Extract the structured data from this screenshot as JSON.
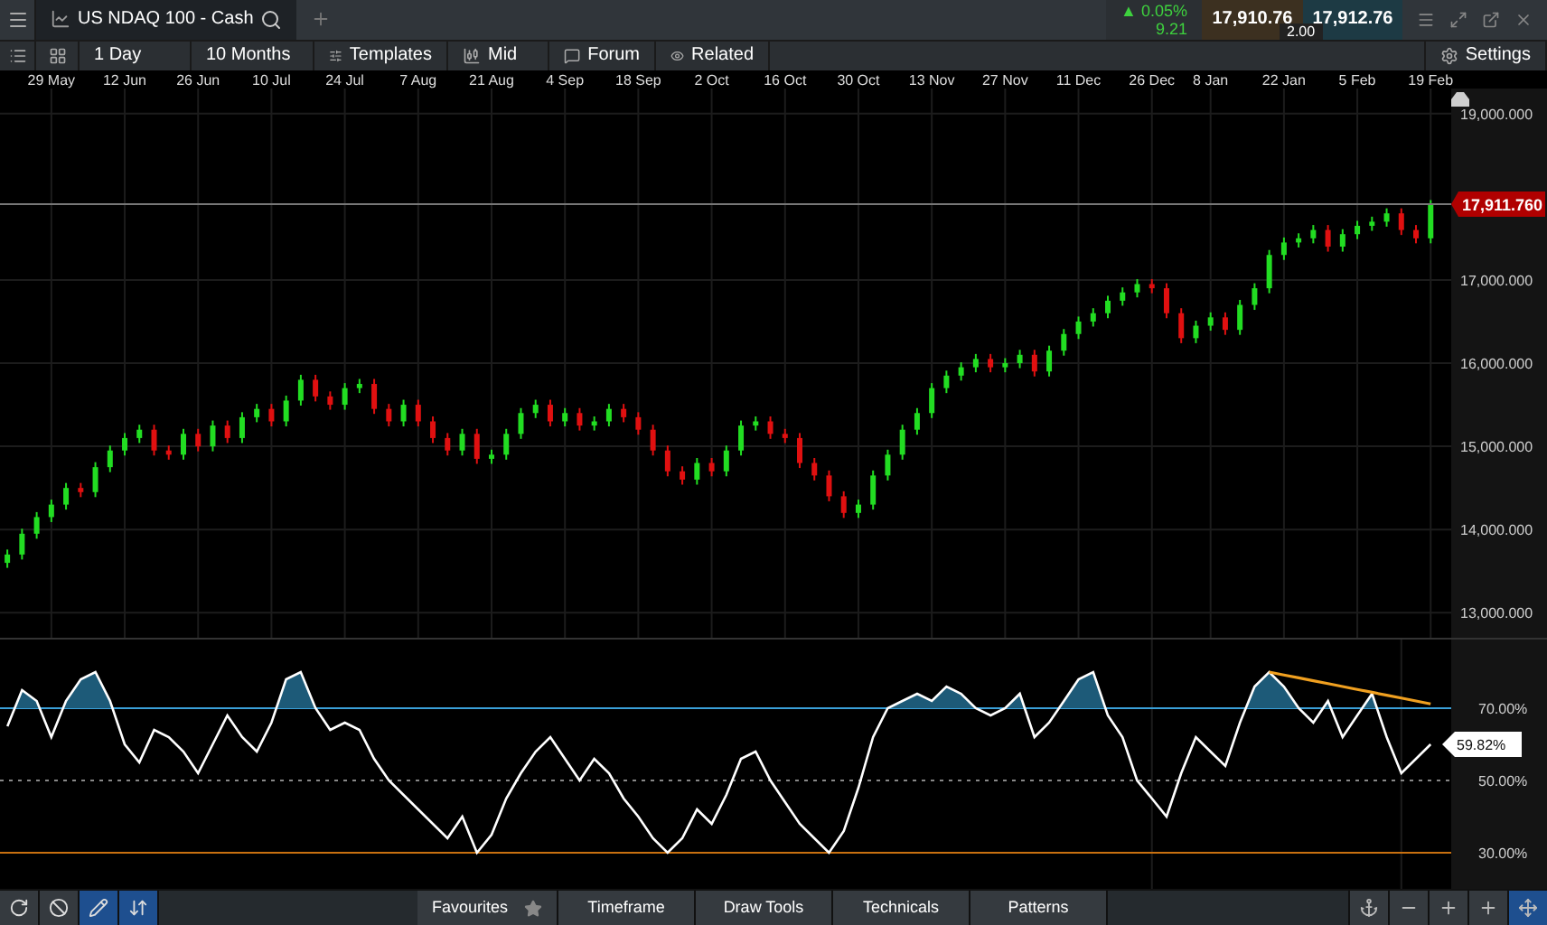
{
  "tab": {
    "title": "US NDAQ 100 - Cash"
  },
  "quote": {
    "change_arrow": "▲",
    "change": "0.05%",
    "change_points": "9.21",
    "sell": "17,910.76",
    "buy": "17,912.76",
    "spread": "2.00"
  },
  "toolbar": {
    "interval": "1 Day",
    "period": "10 Months",
    "templates": "Templates",
    "price_type": "Mid",
    "forum": "Forum",
    "related": "Related",
    "settings": "Settings"
  },
  "price_chart": {
    "chart_data": {
      "type": "candlestick",
      "grid": true,
      "categories": [
        null,
        null,
        null,
        "29 May",
        null,
        null,
        null,
        null,
        "12 Jun",
        null,
        null,
        null,
        null,
        "26 Jun",
        null,
        null,
        null,
        null,
        "10 Jul",
        null,
        null,
        null,
        null,
        "24 Jul",
        null,
        null,
        null,
        null,
        "7 Aug",
        null,
        null,
        null,
        null,
        "21 Aug",
        null,
        null,
        null,
        null,
        "4 Sep",
        null,
        null,
        null,
        null,
        "18 Sep",
        null,
        null,
        null,
        null,
        "2 Oct",
        null,
        null,
        null,
        null,
        "16 Oct",
        null,
        null,
        null,
        null,
        "30 Oct",
        null,
        null,
        null,
        null,
        "13 Nov",
        null,
        null,
        null,
        null,
        "27 Nov",
        null,
        null,
        null,
        null,
        "11 Dec",
        null,
        null,
        null,
        null,
        "26 Dec",
        null,
        null,
        null,
        "8 Jan",
        null,
        null,
        null,
        null,
        "22 Jan",
        null,
        null,
        null,
        null,
        "5 Feb",
        null,
        null,
        null,
        null,
        "19 Feb"
      ],
      "ohlc": [
        [
          13600,
          13760,
          13540,
          13700
        ],
        [
          13700,
          14010,
          13640,
          13950
        ],
        [
          13950,
          14210,
          13890,
          14150
        ],
        [
          14150,
          14360,
          14090,
          14300
        ],
        [
          14300,
          14560,
          14240,
          14500
        ],
        [
          14500,
          14560,
          14390,
          14450
        ],
        [
          14450,
          14810,
          14390,
          14750
        ],
        [
          14750,
          15010,
          14690,
          14950
        ],
        [
          14950,
          15160,
          14890,
          15100
        ],
        [
          15100,
          15260,
          15040,
          15200
        ],
        [
          15200,
          15260,
          14890,
          14950
        ],
        [
          14950,
          15010,
          14840,
          14900
        ],
        [
          14900,
          15210,
          14840,
          15150
        ],
        [
          15150,
          15210,
          14940,
          15000
        ],
        [
          15000,
          15310,
          14940,
          15250
        ],
        [
          15250,
          15310,
          15040,
          15100
        ],
        [
          15100,
          15410,
          15040,
          15350
        ],
        [
          15350,
          15510,
          15290,
          15450
        ],
        [
          15450,
          15510,
          15240,
          15300
        ],
        [
          15300,
          15610,
          15240,
          15550
        ],
        [
          15550,
          15860,
          15490,
          15800
        ],
        [
          15800,
          15860,
          15540,
          15600
        ],
        [
          15600,
          15660,
          15440,
          15500
        ],
        [
          15500,
          15760,
          15440,
          15700
        ],
        [
          15700,
          15810,
          15640,
          15750
        ],
        [
          15750,
          15810,
          15390,
          15450
        ],
        [
          15450,
          15510,
          15240,
          15300
        ],
        [
          15300,
          15560,
          15240,
          15500
        ],
        [
          15500,
          15560,
          15240,
          15300
        ],
        [
          15300,
          15360,
          15040,
          15100
        ],
        [
          15100,
          15160,
          14890,
          14950
        ],
        [
          14950,
          15210,
          14890,
          15150
        ],
        [
          15150,
          15210,
          14790,
          14850
        ],
        [
          14850,
          14960,
          14790,
          14900
        ],
        [
          14900,
          15210,
          14840,
          15150
        ],
        [
          15150,
          15460,
          15090,
          15400
        ],
        [
          15400,
          15560,
          15340,
          15500
        ],
        [
          15500,
          15560,
          15240,
          15300
        ],
        [
          15300,
          15460,
          15240,
          15400
        ],
        [
          15400,
          15460,
          15190,
          15250
        ],
        [
          15250,
          15360,
          15190,
          15300
        ],
        [
          15300,
          15510,
          15240,
          15450
        ],
        [
          15450,
          15510,
          15290,
          15350
        ],
        [
          15350,
          15410,
          15140,
          15200
        ],
        [
          15200,
          15260,
          14890,
          14950
        ],
        [
          14950,
          15010,
          14640,
          14700
        ],
        [
          14700,
          14760,
          14540,
          14600
        ],
        [
          14600,
          14860,
          14540,
          14800
        ],
        [
          14800,
          14860,
          14640,
          14700
        ],
        [
          14700,
          15010,
          14640,
          14950
        ],
        [
          14950,
          15310,
          14890,
          15250
        ],
        [
          15250,
          15360,
          15190,
          15300
        ],
        [
          15300,
          15360,
          15090,
          15150
        ],
        [
          15150,
          15210,
          15040,
          15100
        ],
        [
          15100,
          15160,
          14740,
          14800
        ],
        [
          14800,
          14860,
          14590,
          14650
        ],
        [
          14650,
          14710,
          14340,
          14400
        ],
        [
          14400,
          14460,
          14140,
          14200
        ],
        [
          14200,
          14360,
          14140,
          14300
        ],
        [
          14300,
          14710,
          14240,
          14650
        ],
        [
          14650,
          14960,
          14590,
          14900
        ],
        [
          14900,
          15260,
          14840,
          15200
        ],
        [
          15200,
          15460,
          15140,
          15400
        ],
        [
          15400,
          15760,
          15340,
          15700
        ],
        [
          15700,
          15910,
          15640,
          15850
        ],
        [
          15850,
          16010,
          15790,
          15950
        ],
        [
          15950,
          16110,
          15890,
          16050
        ],
        [
          16050,
          16110,
          15890,
          15950
        ],
        [
          15950,
          16060,
          15890,
          16000
        ],
        [
          16000,
          16160,
          15940,
          16100
        ],
        [
          16100,
          16160,
          15840,
          15900
        ],
        [
          15900,
          16210,
          15840,
          16150
        ],
        [
          16150,
          16410,
          16090,
          16350
        ],
        [
          16350,
          16560,
          16290,
          16500
        ],
        [
          16500,
          16660,
          16440,
          16600
        ],
        [
          16600,
          16810,
          16540,
          16750
        ],
        [
          16750,
          16910,
          16690,
          16850
        ],
        [
          16850,
          17010,
          16790,
          16950
        ],
        [
          16950,
          17010,
          16840,
          16900
        ],
        [
          16900,
          16960,
          16540,
          16600
        ],
        [
          16600,
          16660,
          16240,
          16300
        ],
        [
          16300,
          16510,
          16240,
          16450
        ],
        [
          16450,
          16610,
          16390,
          16550
        ],
        [
          16550,
          16610,
          16340,
          16400
        ],
        [
          16400,
          16760,
          16340,
          16700
        ],
        [
          16700,
          16960,
          16640,
          16900
        ],
        [
          16900,
          17360,
          16840,
          17300
        ],
        [
          17300,
          17510,
          17240,
          17450
        ],
        [
          17450,
          17560,
          17390,
          17500
        ],
        [
          17500,
          17660,
          17440,
          17600
        ],
        [
          17600,
          17660,
          17340,
          17400
        ],
        [
          17400,
          17610,
          17340,
          17550
        ],
        [
          17550,
          17710,
          17490,
          17650
        ],
        [
          17650,
          17760,
          17590,
          17700
        ],
        [
          17700,
          17860,
          17640,
          17800
        ],
        [
          17800,
          17860,
          17540,
          17600
        ],
        [
          17600,
          17660,
          17440,
          17500
        ],
        [
          17500,
          17960,
          17440,
          17900
        ]
      ],
      "ylim": [
        12700,
        19300
      ],
      "yticks": [
        {
          "value": 13000,
          "label": "13,000.000"
        },
        {
          "value": 14000,
          "label": "14,000.000"
        },
        {
          "value": 15000,
          "label": "15,000.000"
        },
        {
          "value": 16000,
          "label": "16,000.000"
        },
        {
          "value": 17000,
          "label": "17,000.000"
        },
        {
          "value": 19000,
          "label": "19,000.000"
        }
      ],
      "ref_lines": [
        {
          "axis": "y",
          "value": 17911.76,
          "label": "17,911.760",
          "color": "#777777"
        }
      ]
    }
  },
  "rsi_chart": {
    "current_value_label": "59.82%",
    "chart_data": {
      "type": "line",
      "grid": true,
      "ylim": [
        19,
        89
      ],
      "categories": [
        null,
        null,
        null,
        null,
        null,
        null,
        null,
        null,
        null,
        null,
        null,
        null,
        null,
        null,
        null,
        null,
        null,
        null,
        null,
        null,
        null,
        null,
        null,
        null,
        null,
        null,
        null,
        null,
        null,
        null,
        null,
        null,
        null,
        null,
        null,
        null,
        null,
        null,
        null,
        null,
        null,
        null,
        null,
        null,
        null,
        null,
        null,
        null,
        null,
        null,
        null,
        null,
        null,
        null,
        null,
        null,
        null,
        null,
        null,
        null,
        null,
        null,
        null,
        null,
        null,
        null,
        null,
        null,
        null,
        null,
        null,
        null,
        null,
        null,
        null,
        null,
        null,
        null,
        null,
        null,
        null,
        null,
        null,
        null,
        null,
        null,
        null,
        null,
        null,
        null,
        null,
        null,
        null,
        null,
        null,
        null,
        null,
        null
      ],
      "series": [
        {
          "color": "#ffffff",
          "values": [
            65,
            75,
            72,
            62,
            72,
            78,
            80,
            72,
            60,
            55,
            64,
            62,
            58,
            52,
            60,
            68,
            62,
            58,
            66,
            78,
            80,
            70,
            64,
            66,
            64,
            56,
            50,
            46,
            42,
            38,
            34,
            40,
            30,
            35,
            45,
            52,
            58,
            62,
            56,
            50,
            56,
            52,
            45,
            40,
            34,
            30,
            34,
            42,
            38,
            46,
            56,
            58,
            50,
            44,
            38,
            34,
            30,
            36,
            48,
            62,
            70,
            72,
            74,
            72,
            76,
            74,
            70,
            68,
            70,
            74,
            62,
            66,
            72,
            78,
            80,
            68,
            62,
            50,
            45,
            40,
            52,
            62,
            58,
            54,
            66,
            76,
            80,
            76,
            70,
            66,
            72,
            62,
            68,
            74,
            62,
            52,
            56,
            60
          ]
        },
        {
          "color": "#f0a020",
          "values": [
            null,
            null,
            null,
            null,
            null,
            null,
            null,
            null,
            null,
            null,
            null,
            null,
            null,
            null,
            null,
            null,
            null,
            null,
            null,
            null,
            null,
            null,
            null,
            null,
            null,
            null,
            null,
            null,
            null,
            null,
            null,
            null,
            null,
            null,
            null,
            null,
            null,
            null,
            null,
            null,
            null,
            null,
            null,
            null,
            null,
            null,
            null,
            null,
            null,
            null,
            null,
            null,
            null,
            null,
            null,
            null,
            null,
            null,
            null,
            null,
            null,
            null,
            null,
            null,
            null,
            null,
            null,
            null,
            null,
            null,
            null,
            null,
            null,
            null,
            null,
            null,
            null,
            null,
            null,
            null,
            null,
            null,
            null,
            null,
            null,
            null,
            80,
            79.2,
            78.4,
            77.6,
            76.8,
            76,
            75.2,
            74.4,
            73.6,
            72.8,
            72,
            71.2
          ]
        }
      ],
      "yticks": [
        {
          "value": 30,
          "label": "30.00%"
        },
        {
          "value": 50,
          "label": "50.00%"
        },
        {
          "value": 70,
          "label": "70.00%"
        }
      ],
      "ref_lines": [
        {
          "axis": "y",
          "value": 30,
          "color": "#c87010"
        },
        {
          "axis": "y",
          "value": 50,
          "color": "#888888"
        },
        {
          "axis": "y",
          "value": 70,
          "color": "#3aa0d8"
        }
      ]
    }
  },
  "bottom_bar": {
    "left_tools": [
      {
        "selected": false
      },
      {
        "selected": false
      },
      {
        "selected": true
      },
      {
        "selected": true
      }
    ],
    "tabs": [
      "Favourites",
      "Timeframe",
      "Draw Tools",
      "Technicals",
      "Patterns"
    ],
    "right_tools": [
      {
        "selected": false
      },
      {
        "selected": false
      },
      {
        "selected": false
      },
      {
        "selected": false
      },
      {
        "selected": true
      }
    ]
  }
}
